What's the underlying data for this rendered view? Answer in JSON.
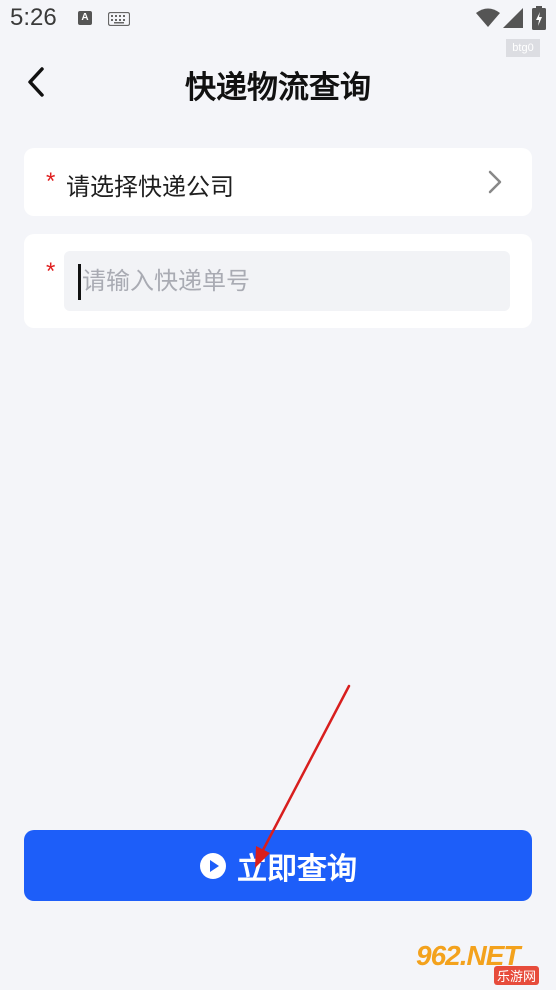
{
  "status_bar": {
    "time": "5:26",
    "a_glyph": "A",
    "icons": [
      "a-icon",
      "keyboard-icon",
      "wifi-icon",
      "signal-icon",
      "battery-icon"
    ],
    "watermark": "btg0"
  },
  "header": {
    "title": "快递物流查询",
    "back_icon": "chevron-left-icon"
  },
  "form": {
    "company": {
      "required_mark": "*",
      "label": "请选择快递公司",
      "chevron_icon": "chevron-right-icon"
    },
    "tracking_number": {
      "required_mark": "*",
      "value": "",
      "placeholder": "请输入快递单号"
    }
  },
  "actions": {
    "query_label": "立即查询",
    "query_icon": "play-circle-icon"
  },
  "colors": {
    "background": "#f4f5f9",
    "primary": "#1d5ef9",
    "required": "#e02020",
    "annotation": "#d81e1e"
  },
  "logo": {
    "main": "962.NET",
    "sub": "乐游网"
  }
}
